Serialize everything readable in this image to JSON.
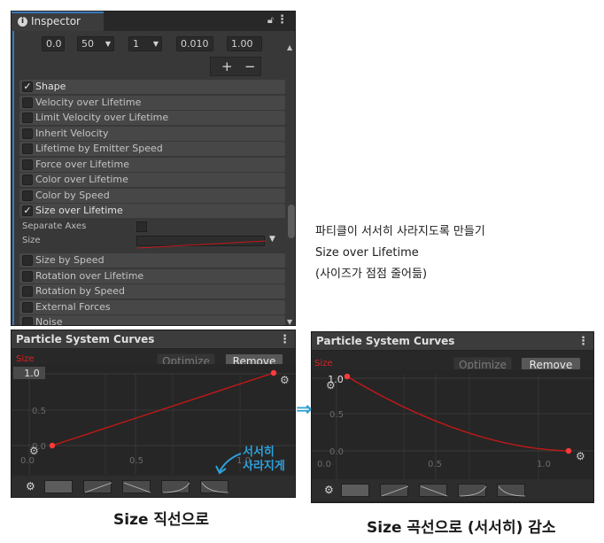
{
  "inspector": {
    "tab_label": "Inspector",
    "fields": [
      "0.0",
      "50",
      "1",
      "0.010",
      "1.00"
    ],
    "plus": "+",
    "minus": "−",
    "modules": [
      {
        "label": "Shape",
        "checked": true
      },
      {
        "label": "Velocity over Lifetime",
        "checked": false
      },
      {
        "label": "Limit Velocity over Lifetime",
        "checked": false
      },
      {
        "label": "Inherit Velocity",
        "checked": false
      },
      {
        "label": "Lifetime by Emitter Speed",
        "checked": false
      },
      {
        "label": "Force over Lifetime",
        "checked": false
      },
      {
        "label": "Color over Lifetime",
        "checked": false
      },
      {
        "label": "Color by Speed",
        "checked": false
      },
      {
        "label": "Size over Lifetime",
        "checked": true
      }
    ],
    "size_module": {
      "separate_axes_label": "Separate Axes",
      "size_label": "Size"
    },
    "modules_after": [
      {
        "label": "Size by Speed",
        "checked": false
      },
      {
        "label": "Rotation over Lifetime",
        "checked": false
      },
      {
        "label": "Rotation by Speed",
        "checked": false
      },
      {
        "label": "External Forces",
        "checked": false
      },
      {
        "label": "Noise",
        "checked": false
      }
    ]
  },
  "curves_left": {
    "title": "Particle System Curves",
    "optimize": "Optimize",
    "remove": "Remove",
    "size_label": "Size",
    "y_labels": [
      "1.0",
      "0.5",
      "0.0"
    ],
    "x_labels": [
      "0.0",
      "0.5",
      "1.0"
    ]
  },
  "curves_right": {
    "title": "Particle System Curves",
    "optimize": "Optimize",
    "remove": "Remove",
    "size_label": "Size",
    "y_labels": [
      "1.0",
      "0.5",
      "0.0"
    ],
    "x_labels": [
      "0.0",
      "0.5",
      "1.0"
    ]
  },
  "annotations": {
    "note_line1": "파티클이 서서히 사라지도록 만들기",
    "note_line2": "Size over Lifetime",
    "note_line3": "(사이즈가 점점 줄어듦)",
    "hand_left_blue_1": "서서히",
    "hand_left_blue_2": "사라지게",
    "caption_left": "Size 직선으로",
    "caption_right": "Size 곡선으로 (서서히) 감소",
    "arrow": "⇒"
  },
  "colors": {
    "panel_bg": "#383838",
    "curve_bg": "#282828",
    "curve_red": "#c41818",
    "accent_blue": "#3a79bb"
  }
}
